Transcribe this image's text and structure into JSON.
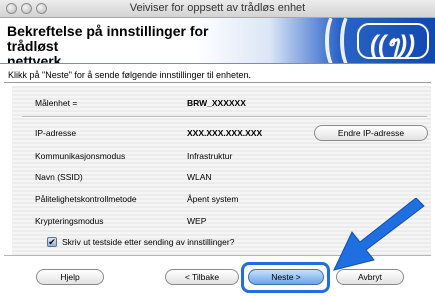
{
  "window": {
    "title": "Veiviser for oppsett av trådløs enhet"
  },
  "header": {
    "title_line1": "Bekreftelse på innstillinger for trådløst",
    "title_line2": "nettverk."
  },
  "instructions": "Klikk på \"Neste\" for å sende følgende innstillinger til enheten.",
  "settings": {
    "target_label": "Målenhet =",
    "target_value": "BRW_XXXXXX",
    "ip_label": "IP-adresse",
    "ip_value": "XXX.XXX.XXX.XXX",
    "change_ip_button": "Endre IP-adresse",
    "mode_label": "Kommunikasjonsmodus",
    "mode_value": "Infrastruktur",
    "ssid_label": "Navn (SSID)",
    "ssid_value": "WLAN",
    "auth_label": "Pålitelighetskontrollmetode",
    "auth_value": "Åpent system",
    "enc_label": "Krypteringsmodus",
    "enc_value": "WEP"
  },
  "checkbox": {
    "label": "Skriv ut testside etter sending av innstillinger?",
    "checked": true
  },
  "buttons": {
    "help": "Hjelp",
    "back": "< Tilbake",
    "next": "Neste >",
    "cancel": "Avbryt"
  },
  "annotation": {
    "arrow_color": "#1f6fe0"
  },
  "icons": [
    "close-button",
    "minimize-button",
    "zoom-button",
    "wireless-logo",
    "checkmark-icon",
    "pointer-arrow"
  ]
}
